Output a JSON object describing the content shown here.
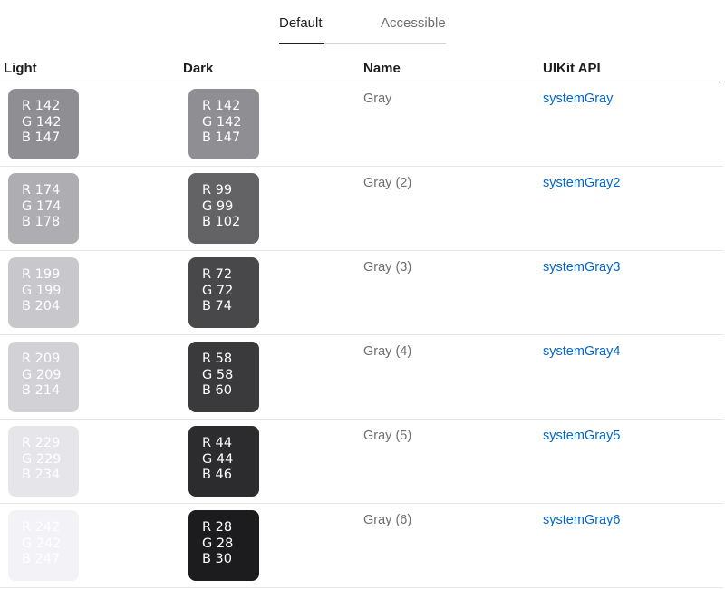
{
  "tabs": {
    "default_label": "Default",
    "accessible_label": "Accessible"
  },
  "table": {
    "headers": {
      "light": "Light",
      "dark": "Dark",
      "name": "Name",
      "api": "UIKit API"
    },
    "rows": [
      {
        "name": "Gray",
        "api": "systemGray",
        "light": {
          "r": "R 142",
          "g": "G 142",
          "b": "B 147",
          "color": "#8e8e93",
          "text_color": "#ffffff"
        },
        "dark": {
          "r": "R 142",
          "g": "G 142",
          "b": "B 147",
          "color": "#8e8e93",
          "text_color": "#ffffff"
        }
      },
      {
        "name": "Gray (2)",
        "api": "systemGray2",
        "light": {
          "r": "R 174",
          "g": "G 174",
          "b": "B 178",
          "color": "#aeaeb2",
          "text_color": "#ffffff"
        },
        "dark": {
          "r": "R 99",
          "g": "G 99",
          "b": "B 102",
          "color": "#636366",
          "text_color": "#ffffff"
        }
      },
      {
        "name": "Gray (3)",
        "api": "systemGray3",
        "light": {
          "r": "R 199",
          "g": "G 199",
          "b": "B 204",
          "color": "#c7c7cc",
          "text_color": "#ffffff"
        },
        "dark": {
          "r": "R 72",
          "g": "G 72",
          "b": "B 74",
          "color": "#48484a",
          "text_color": "#ffffff"
        }
      },
      {
        "name": "Gray (4)",
        "api": "systemGray4",
        "light": {
          "r": "R 209",
          "g": "G 209",
          "b": "B 214",
          "color": "#d1d1d6",
          "text_color": "#ffffff"
        },
        "dark": {
          "r": "R 58",
          "g": "G 58",
          "b": "B 60",
          "color": "#3a3a3c",
          "text_color": "#ffffff"
        }
      },
      {
        "name": "Gray (5)",
        "api": "systemGray5",
        "light": {
          "r": "R 229",
          "g": "G 229",
          "b": "B 234",
          "color": "#e5e5ea",
          "text_color": "#ffffff"
        },
        "dark": {
          "r": "R 44",
          "g": "G 44",
          "b": "B 46",
          "color": "#2c2c2e",
          "text_color": "#ffffff"
        }
      },
      {
        "name": "Gray (6)",
        "api": "systemGray6",
        "light": {
          "r": "R 242",
          "g": "G 242",
          "b": "B 247",
          "color": "#f2f2f7",
          "text_color": "#ffffff"
        },
        "dark": {
          "r": "R 28",
          "g": "G 28",
          "b": "B 30",
          "color": "#1c1c1e",
          "text_color": "#ffffff"
        }
      }
    ]
  }
}
